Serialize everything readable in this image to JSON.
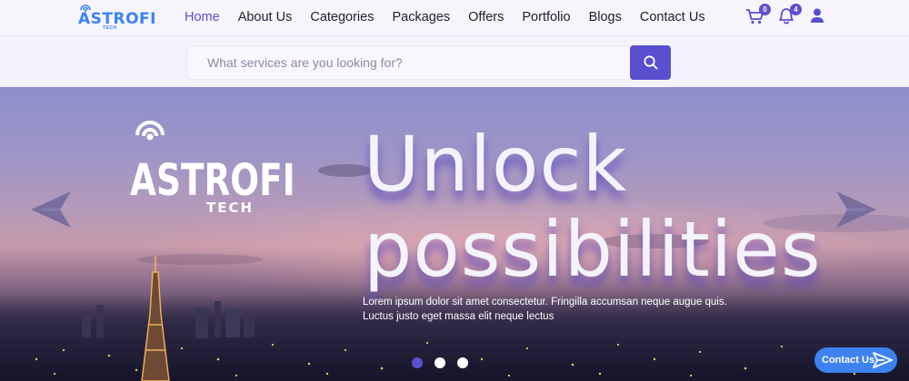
{
  "header": {
    "logo_text": "ASTROFI",
    "logo_sub": "TECH",
    "nav": [
      {
        "label": "Home",
        "active": true
      },
      {
        "label": "About Us",
        "active": false
      },
      {
        "label": "Categories",
        "active": false
      },
      {
        "label": "Packages",
        "active": false
      },
      {
        "label": "Offers",
        "active": false
      },
      {
        "label": "Portfolio",
        "active": false
      },
      {
        "label": "Blogs",
        "active": false
      },
      {
        "label": "Contact Us",
        "active": false
      }
    ],
    "cart_count": "0",
    "notification_count": "4",
    "icons": [
      "cart-icon",
      "bell-icon",
      "user-icon"
    ]
  },
  "search": {
    "placeholder": "What services are you looking for?",
    "value": "",
    "button_icon": "search-icon"
  },
  "hero": {
    "logo_text": "ASTROFI",
    "logo_sub": "TECH",
    "headline_line1": "Unlock",
    "headline_line2": "possibilities",
    "description": "Lorem ipsum dolor sit amet consectetur. Fringilla accumsan neque augue quis. Luctus justo eget massa elit neque lectus",
    "slides": 3,
    "active_slide": 1,
    "prev_icon": "arrow-left-icon",
    "next_icon": "arrow-right-icon"
  },
  "contact_fab": {
    "label": "Contact Us",
    "icon": "send-icon"
  },
  "colors": {
    "accent": "#5a4fcf",
    "fab_blue": "#3d82f0",
    "logo_blue": "#3b82f6"
  }
}
